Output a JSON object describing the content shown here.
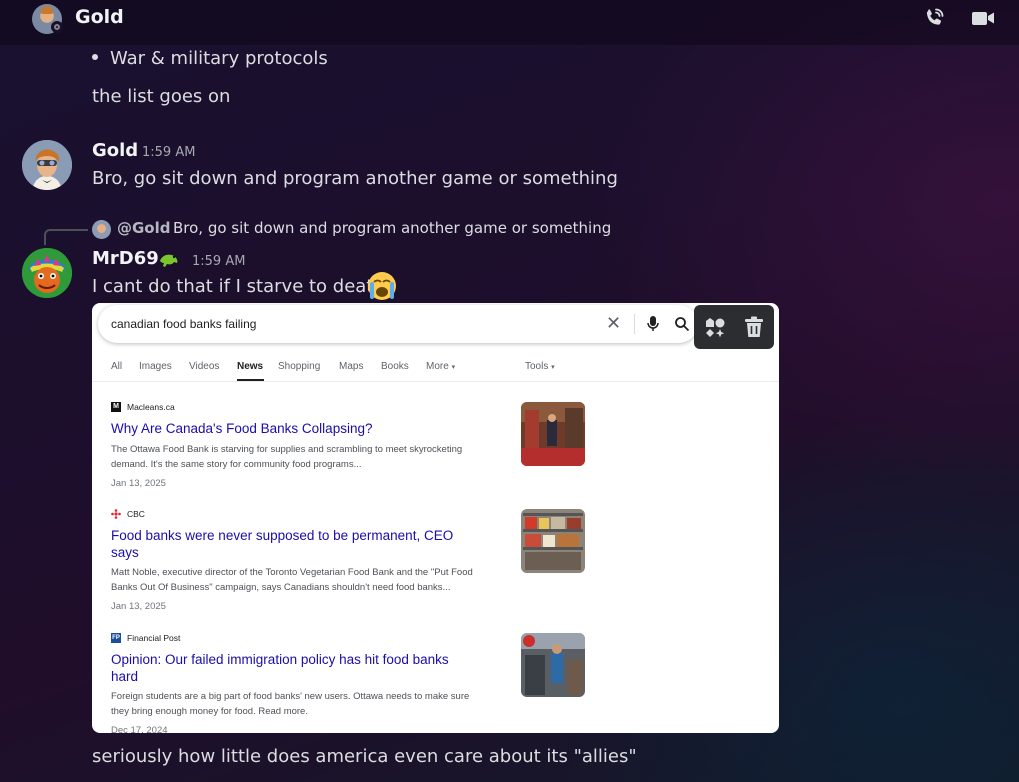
{
  "header": {
    "channel_name": "Gold",
    "call_icon": "phone-call-icon",
    "video_icon": "video-camera-icon"
  },
  "previous": {
    "bullet": "War & military protocols",
    "line": "the list goes on"
  },
  "messages": [
    {
      "author": "Gold",
      "time": "1:59 AM",
      "text": "Bro, go sit down and program another game or something"
    },
    {
      "author": "MrD69",
      "time": "1:59 AM",
      "reply": {
        "mention": "@Gold",
        "text": "Bro, go sit down and program another game or something"
      },
      "text": "I cant do that if I starve to death",
      "followup": "seriously how little does america even care about its \"allies\""
    }
  ],
  "attachment": {
    "query": "canadian food banks failing",
    "tabs": [
      "All",
      "Images",
      "Videos",
      "News",
      "Shopping",
      "Maps",
      "Books",
      "More",
      "Tools"
    ],
    "active_tab": "News",
    "results": [
      {
        "source": "Macleans.ca",
        "title": "Why Are Canada's Food Banks Collapsing?",
        "snippet_1": "The Ottawa Food Bank is starving for supplies and scrambling to meet skyrocketing",
        "snippet_2": "demand. It's the same story for community food programs...",
        "date": "Jan 13, 2025"
      },
      {
        "source": "CBC",
        "title_1": "Food banks were never supposed to be permanent, CEO",
        "title_2": "says",
        "snippet_1": "Matt Noble, executive director of the Toronto Vegetarian Food Bank and the \"Put Food",
        "snippet_2": "Banks Out Of Business\" campaign, says Canadians shouldn't need food banks...",
        "date": "Jan 13, 2025"
      },
      {
        "source": "Financial Post",
        "title_1": "Opinion: Our failed immigration policy has hit food banks",
        "title_2": "hard",
        "snippet_1": "Foreign students are a big part of food banks' new users. Ottawa needs to make sure",
        "snippet_2": "they bring enough money for food. Read more.",
        "date": "Dec 17, 2024"
      }
    ]
  },
  "colors": {
    "link_blue": "#1a0dab",
    "text": "#dcdde1",
    "username": "#f2f3f5"
  }
}
